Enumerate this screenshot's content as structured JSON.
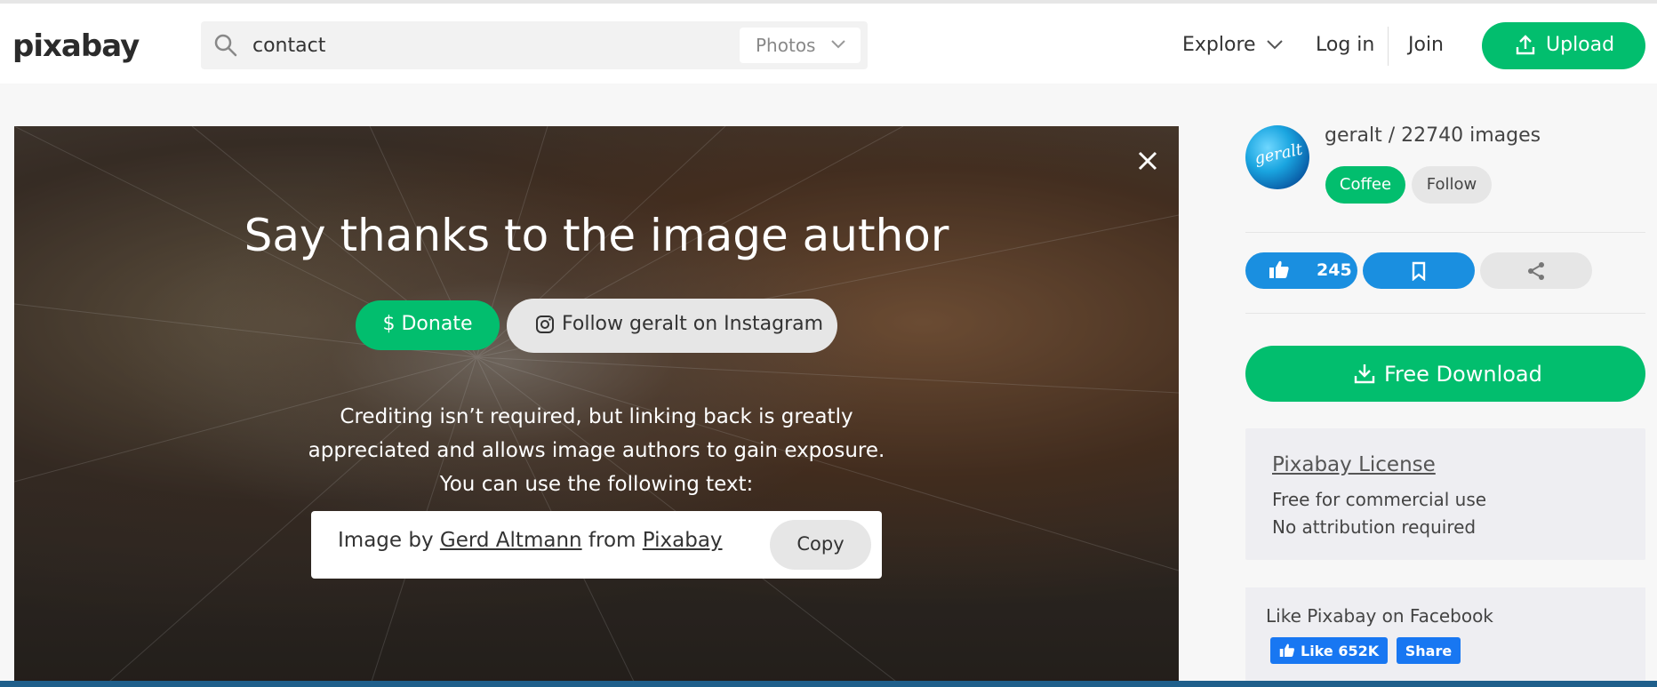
{
  "header": {
    "logo": "pixabay",
    "search_value": "contact",
    "search_type": "Photos",
    "nav": {
      "explore": "Explore",
      "login": "Log in",
      "join": "Join",
      "upload": "Upload"
    }
  },
  "image_panel": {
    "title": "Say thanks to the image author",
    "donate_label": "$ Donate",
    "instagram_label": "Follow geralt on Instagram",
    "credit_lines": [
      "Crediting isn’t required, but linking back is greatly",
      "appreciated and allows image authors to gain exposure.",
      "You can use the following text:"
    ],
    "attribution": {
      "prefix": "Image by ",
      "author": "Gerd Altmann",
      "middle": " from ",
      "site": "Pixabay"
    },
    "copy_label": "Copy"
  },
  "sidebar": {
    "avatar_signature": "geralt",
    "author_line": "geralt / 22740 images",
    "coffee_label": "Coffee",
    "follow_label": "Follow",
    "likes": "245",
    "download_label": "Free Download",
    "license": {
      "title": "Pixabay License",
      "line1": "Free for commercial use",
      "line2": "No attribution required"
    },
    "facebook": {
      "title": "Like Pixabay on Facebook",
      "like_label": "Like 652K",
      "share_label": "Share"
    }
  },
  "colors": {
    "brand_green": "#02be6e",
    "action_blue": "#1a8fe0",
    "facebook_blue": "#1877f2"
  }
}
